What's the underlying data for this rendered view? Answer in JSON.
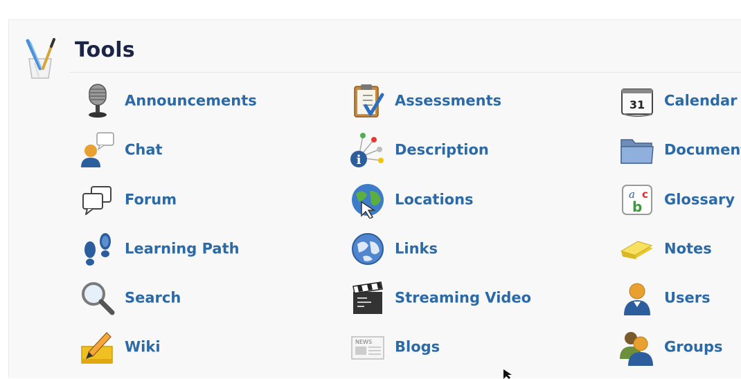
{
  "header": {
    "title": "Tools",
    "icon": "tools-cup-icon"
  },
  "tools": [
    {
      "label": "Announcements",
      "icon": "microphone-icon"
    },
    {
      "label": "Assessments",
      "icon": "clipboard-check-icon"
    },
    {
      "label": "Calendar",
      "icon": "calendar-icon",
      "calendar_day": "31"
    },
    {
      "label": "Chat",
      "icon": "chat-user-icon"
    },
    {
      "label": "Description",
      "icon": "info-molecule-icon"
    },
    {
      "label": "Document",
      "icon": "folder-icon"
    },
    {
      "label": "Forum",
      "icon": "speech-bubbles-icon"
    },
    {
      "label": "Locations",
      "icon": "globe-pointer-icon"
    },
    {
      "label": "Glossary",
      "icon": "abc-glossary-icon",
      "glyphs": [
        "a",
        "b",
        "c"
      ]
    },
    {
      "label": "Learning Path",
      "icon": "footprints-icon"
    },
    {
      "label": "Links",
      "icon": "globe-icon"
    },
    {
      "label": "Notes",
      "icon": "sticky-notes-icon"
    },
    {
      "label": "Search",
      "icon": "magnifier-icon"
    },
    {
      "label": "Streaming Video",
      "icon": "clapperboard-icon"
    },
    {
      "label": "Users",
      "icon": "user-icon"
    },
    {
      "label": "Wiki",
      "icon": "pencil-notepad-icon"
    },
    {
      "label": "Blogs",
      "icon": "newspaper-icon",
      "icon_text": "NEWS"
    },
    {
      "label": "Groups",
      "icon": "group-users-icon"
    }
  ],
  "colors": {
    "title": "#1c2448",
    "link": "#2b6aa6",
    "panel_bg": "#f8f8f8"
  }
}
